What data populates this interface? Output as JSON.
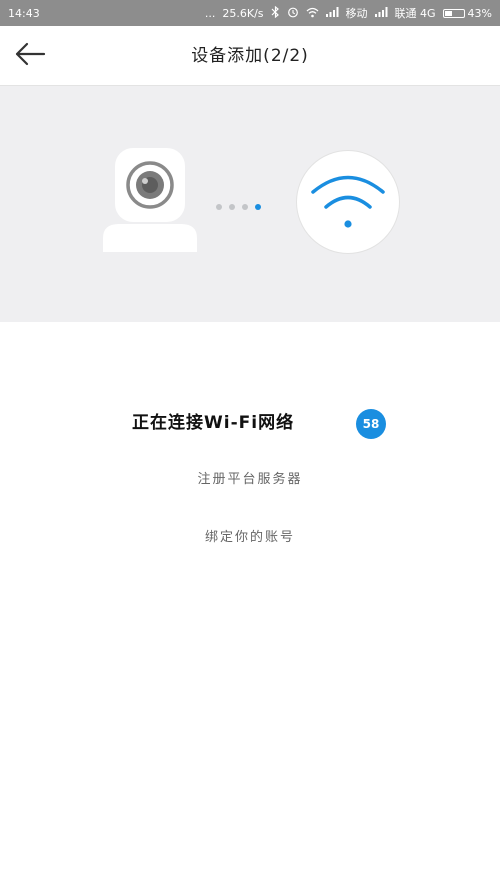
{
  "status_bar": {
    "time": "14:43",
    "dots": "...",
    "speed": "25.6K/s",
    "carrier1": "移动",
    "carrier2": "联通 4G",
    "battery_percent": 43,
    "battery_label": "43%"
  },
  "header": {
    "title": "设备添加(2/2)"
  },
  "progress": {
    "total_dots": 4,
    "active_dot": 4
  },
  "colors": {
    "accent": "#1a8ee0",
    "panel_bg": "#efeff1",
    "status_bg": "#8d8d8d"
  },
  "steps": {
    "current": "正在连接Wi-Fi网络",
    "countdown": "58",
    "next1": "注册平台服务器",
    "next2": "绑定你的账号"
  },
  "icons": {
    "back": "arrow-left-icon",
    "camera": "camera-icon",
    "wifi": "wifi-icon"
  }
}
